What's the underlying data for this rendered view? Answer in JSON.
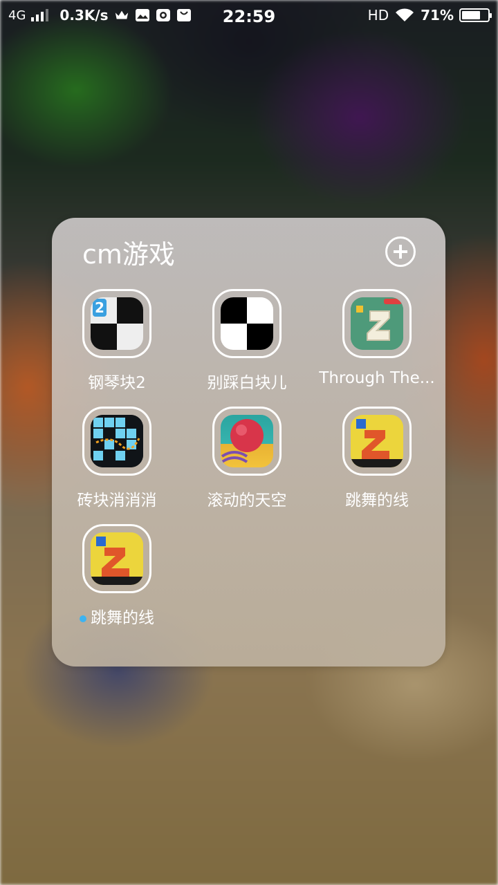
{
  "status_bar": {
    "network": "4G",
    "speed": "0.3K/s",
    "time": "22:59",
    "hd": "HD",
    "battery_pct": "71%",
    "battery_level": 0.71,
    "icons": [
      "signal-icon",
      "crown-icon",
      "image-icon",
      "camera-icon",
      "shopping-bag-icon",
      "wifi-icon",
      "battery-icon"
    ]
  },
  "folder": {
    "title": "cm游戏",
    "add_icon": "plus-circle-icon",
    "apps": [
      {
        "label": "钢琴块2",
        "icon": "piano-tiles-2-icon",
        "new": false
      },
      {
        "label": "别踩白块儿",
        "icon": "dont-tap-white-tile-icon",
        "new": false
      },
      {
        "label": "Through The...",
        "icon": "through-the-icon",
        "new": false
      },
      {
        "label": "砖块消消消",
        "icon": "brick-puzzle-icon",
        "new": false
      },
      {
        "label": "滚动的天空",
        "icon": "rolling-sky-icon",
        "new": false
      },
      {
        "label": "跳舞的线",
        "icon": "dancing-line-icon",
        "new": false
      },
      {
        "label": "跳舞的线",
        "icon": "dancing-line-icon",
        "new": true
      }
    ]
  },
  "colors": {
    "new_dot": "#3db3f0",
    "folder_bg": "#cdc6bd",
    "text": "#ffffff"
  }
}
